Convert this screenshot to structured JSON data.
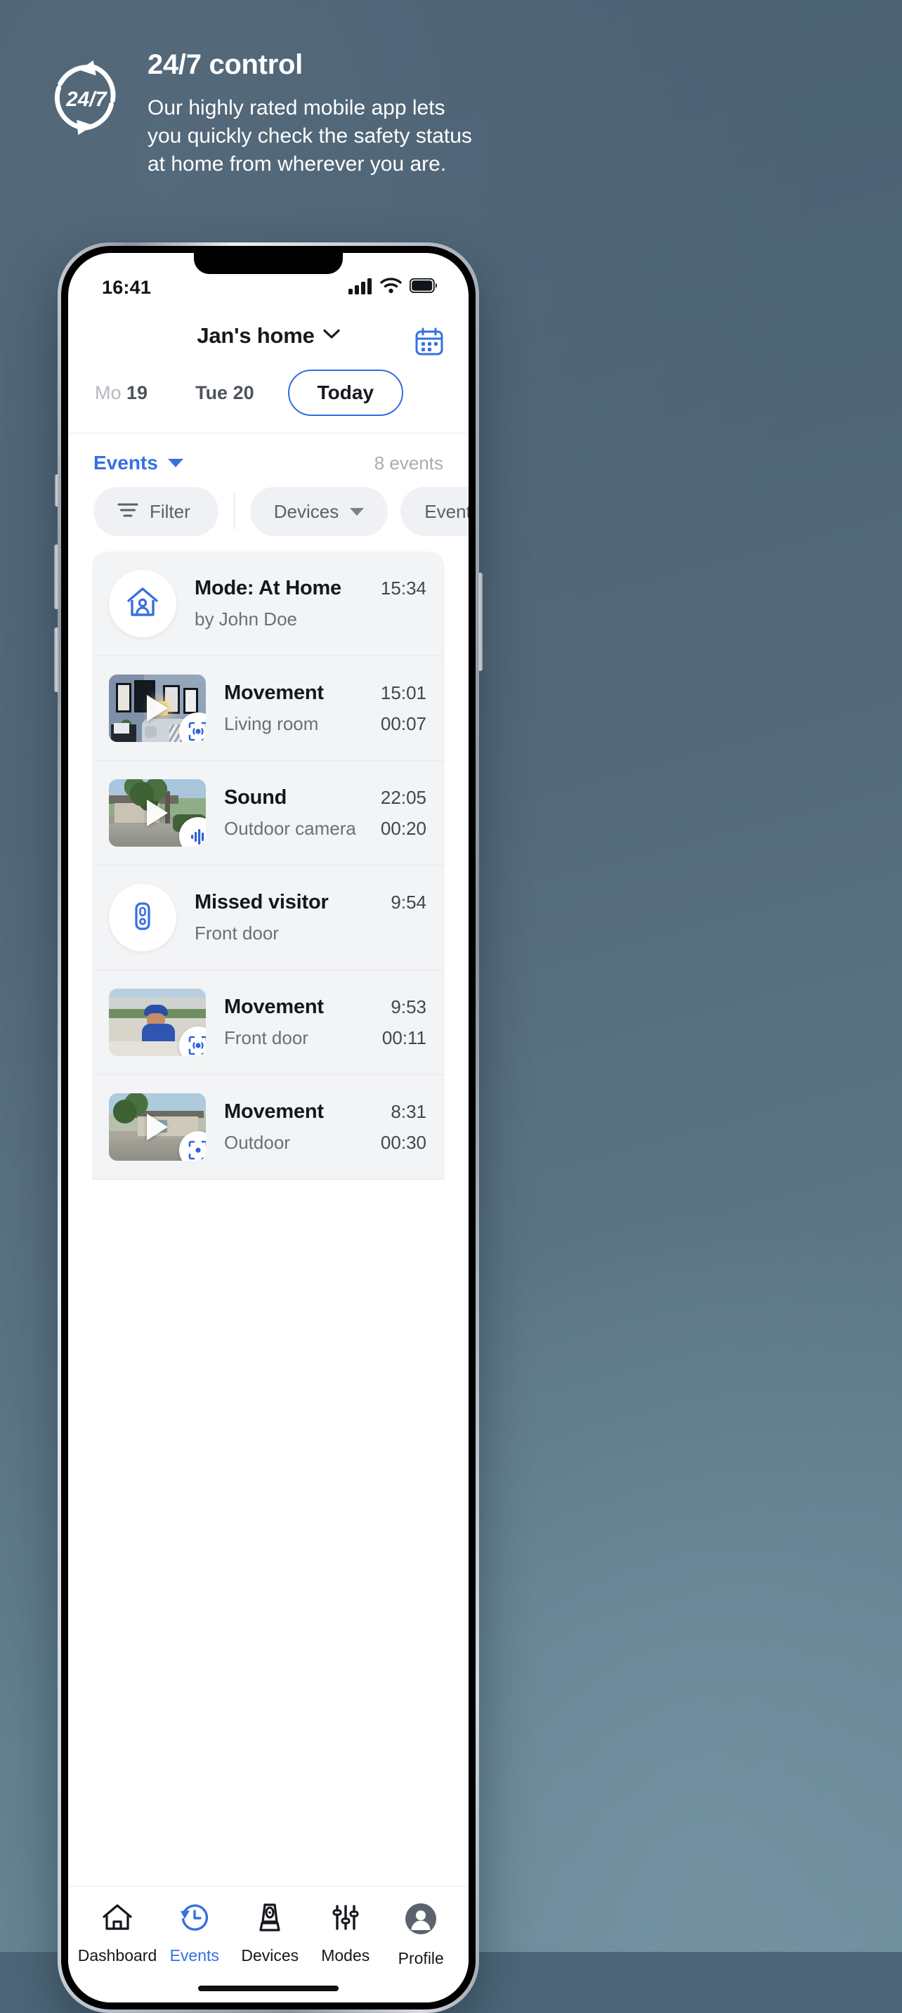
{
  "promo": {
    "badge_text": "24/7",
    "title": "24/7 control",
    "body": "Our highly rated mobile app lets you quickly check the safety status at home from wherever you are."
  },
  "status_bar": {
    "time": "16:41",
    "cellular_icon": "signal-bars-icon",
    "wifi_icon": "wifi-icon",
    "battery_icon": "battery-full-icon"
  },
  "app_header": {
    "title": "Jan's home",
    "chevron_icon": "chevron-down-icon",
    "calendar_icon": "calendar-icon"
  },
  "day_tabs": [
    {
      "dow": "Mo",
      "day": "19",
      "selected": false,
      "dim_dow": true
    },
    {
      "dow": "Tue",
      "day": "20",
      "selected": false,
      "dim_dow": false
    },
    {
      "label": "Today",
      "selected": true
    }
  ],
  "events_bar": {
    "dropdown_label": "Events",
    "dropdown_icon": "triangle-down-icon",
    "count_label": "8 events"
  },
  "filter_chips": [
    {
      "label": "Filter",
      "icon": "filter-lines-icon",
      "has_chevron": false
    },
    {
      "label": "Devices",
      "icon": "",
      "has_chevron": true
    },
    {
      "label": "Event Type",
      "icon": "",
      "has_chevron": true
    }
  ],
  "events": [
    {
      "kind": "mode",
      "icon": "home-person-icon",
      "title": "Mode: At Home",
      "subtitle": "by John Doe",
      "time": "15:34",
      "duration": ""
    },
    {
      "kind": "video",
      "scene": "living",
      "badge_icon": "motion-detect-icon",
      "title": "Movement",
      "subtitle": "Living room",
      "time": "15:01",
      "duration": "00:07"
    },
    {
      "kind": "video",
      "scene": "outdoor",
      "badge_icon": "sound-wave-icon",
      "title": "Sound",
      "subtitle": "Outdoor camera",
      "time": "22:05",
      "duration": "00:20"
    },
    {
      "kind": "doorbell",
      "icon": "doorbell-icon",
      "title": "Missed visitor",
      "subtitle": "Front door",
      "time": "9:54",
      "duration": ""
    },
    {
      "kind": "video",
      "scene": "street",
      "badge_icon": "motion-detect-icon",
      "title": "Movement",
      "subtitle": "Front door",
      "time": "9:53",
      "duration": "00:11"
    },
    {
      "kind": "video",
      "scene": "house",
      "badge_icon": "motion-detect-icon",
      "title": "Movement",
      "subtitle": "Outdoor",
      "time": "8:31",
      "duration": "00:30"
    }
  ],
  "bottom_nav": [
    {
      "label": "Dashboard",
      "icon": "house-icon",
      "active": false
    },
    {
      "label": "Events",
      "icon": "history-clock-icon",
      "active": true
    },
    {
      "label": "Devices",
      "icon": "camera-device-icon",
      "active": false
    },
    {
      "label": "Modes",
      "icon": "sliders-icon",
      "active": false
    },
    {
      "label": "Profile",
      "icon": "avatar-icon",
      "active": false
    }
  ],
  "colors": {
    "accent": "#3770e0",
    "bg": "#4d6779",
    "text": "#14171c",
    "muted": "#6a6f78"
  }
}
